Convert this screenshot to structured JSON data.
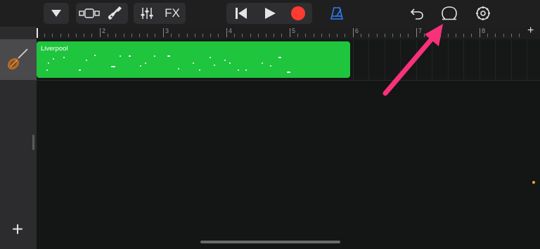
{
  "toolbar": {
    "browser_menu_icon": "triangle-down-icon",
    "view_toggle_icon": "tracks-view-icon",
    "instrument_icon": "guitar-icon",
    "mixer_icon": "sliders-icon",
    "fx_label": "FX",
    "rewind_icon": "skip-back-icon",
    "play_icon": "play-icon",
    "record_icon": "record-icon",
    "record_color": "#ff3b30",
    "metronome_icon": "metronome-icon",
    "metronome_color": "#2f7cf6",
    "undo_icon": "undo-icon",
    "loop_browser_icon": "loop-icon",
    "settings_icon": "gear-icon"
  },
  "ruler": {
    "bar_numbers": [
      "2",
      "3",
      "4",
      "5",
      "6",
      "7",
      "8"
    ],
    "add_section_label": "+"
  },
  "track": {
    "instrument_icon": "violin-icon",
    "region_name": "Liverpool",
    "region_color": "#1ec53d"
  },
  "sidebar": {
    "add_track_label": "+"
  },
  "annotation": {
    "arrow_color": "#f7317a"
  }
}
